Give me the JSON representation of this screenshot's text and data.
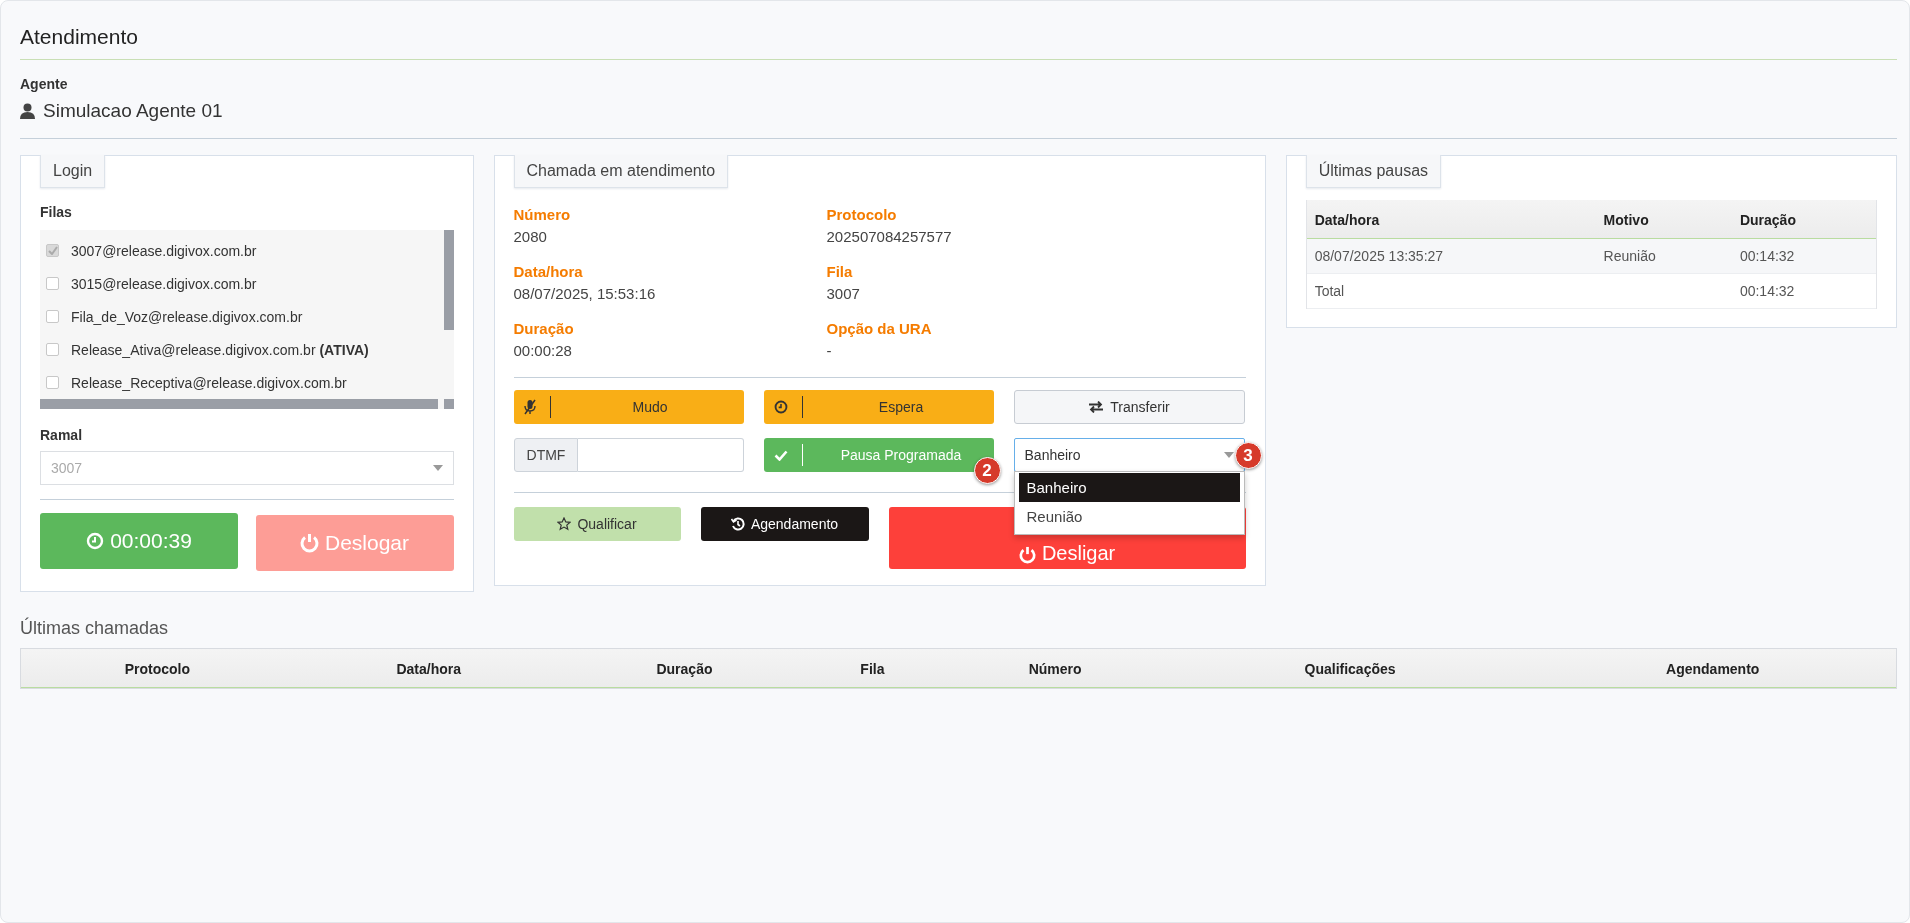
{
  "page_title": "Atendimento",
  "agent": {
    "label": "Agente",
    "name": "Simulacao Agente 01"
  },
  "login": {
    "legend": "Login",
    "queues_label": "Filas",
    "queues": [
      {
        "label": "3007@release.digivox.com.br",
        "checked": true
      },
      {
        "label": "3015@release.digivox.com.br",
        "checked": false
      },
      {
        "label": "Fila_de_Voz@release.digivox.com.br",
        "checked": false
      },
      {
        "label": "Release_Ativa@release.digivox.com.br  **(ATIVA)**",
        "checked": false
      },
      {
        "label": "Release_Receptiva@release.digivox.com.br",
        "checked": false
      }
    ],
    "extension_label": "Ramal",
    "extension": {
      "value": "3007",
      "disabled": true
    },
    "timer_button": "00:00:39",
    "logout_button": {
      "label": "Deslogar",
      "disabled": true
    }
  },
  "call": {
    "legend": "Chamada em atendimento",
    "fields": [
      {
        "label": "Número",
        "value": "2080"
      },
      {
        "label": "Protocolo",
        "value": "202507084257577"
      },
      {
        "label": "Data/hora",
        "value": "08/07/2025, 15:53:16"
      },
      {
        "label": "Fila",
        "value": "3007"
      },
      {
        "label": "Duração",
        "value": "00:00:28"
      },
      {
        "label": "Opção da URA",
        "value": "-"
      }
    ],
    "mute_button": "Mudo",
    "hold_button": "Espera",
    "transfer_button": "Transferir",
    "dtmf": {
      "label": "DTMF"
    },
    "pause_button": "Pausa Programada",
    "pause_badge": "2",
    "pause_select": {
      "value": "Banheiro",
      "badge": "3",
      "expanded": true,
      "options": [
        {
          "label": "Banheiro",
          "selected": true
        },
        {
          "label": "Reunião",
          "selected": false
        }
      ]
    },
    "qualify_button": "Qualificar",
    "schedule_button": "Agendamento",
    "hangup_button": "Desligar"
  },
  "pauses": {
    "legend": "Últimas pausas",
    "columns": [
      "Data/hora",
      "Motivo",
      "Duração"
    ],
    "rows": [
      [
        "08/07/2025 13:35:27",
        "Reunião",
        "00:14:32"
      ]
    ],
    "total": {
      "label": "Total",
      "value": "00:14:32"
    }
  },
  "calls": {
    "title": "Últimas chamadas",
    "columns": [
      "Protocolo",
      "Data/hora",
      "Duração",
      "Fila",
      "Número",
      "Qualificações",
      "Agendamento"
    ]
  }
}
